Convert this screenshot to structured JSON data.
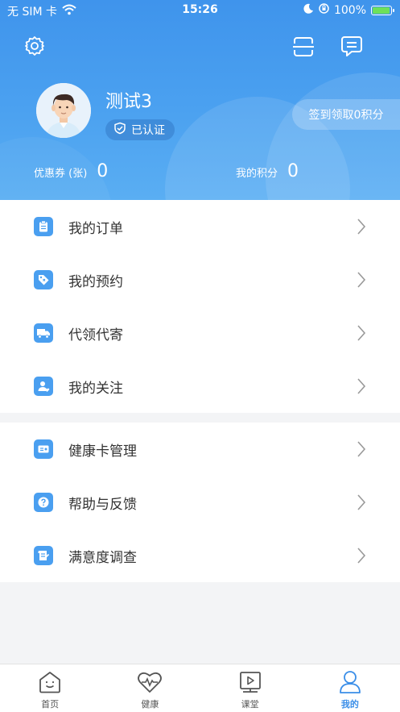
{
  "status_bar": {
    "carrier": "无 SIM 卡",
    "time": "15:26",
    "battery": "100%",
    "battery_level": 1.0
  },
  "profile": {
    "name": "测试3",
    "verified_label": "已认证",
    "checkin_label": "签到领取0积分"
  },
  "stats": {
    "coupons_label": "优惠券 (张)",
    "coupons_value": "0",
    "points_label": "我的积分",
    "points_value": "0"
  },
  "menu_group_1": [
    {
      "label": "我的订单",
      "icon": "clipboard-icon"
    },
    {
      "label": "我的预约",
      "icon": "tag-icon"
    },
    {
      "label": "代领代寄",
      "icon": "truck-icon"
    },
    {
      "label": "我的关注",
      "icon": "user-heart-icon"
    }
  ],
  "menu_group_2": [
    {
      "label": "健康卡管理",
      "icon": "id-card-icon"
    },
    {
      "label": "帮助与反馈",
      "icon": "question-icon"
    },
    {
      "label": "满意度调查",
      "icon": "survey-icon"
    }
  ],
  "tabs": [
    {
      "label": "首页",
      "icon": "home-smile-icon"
    },
    {
      "label": "健康",
      "icon": "heart-pulse-icon"
    },
    {
      "label": "课堂",
      "icon": "video-board-icon"
    },
    {
      "label": "我的",
      "icon": "person-icon",
      "active": true
    }
  ],
  "colors": {
    "brand": "#4a9ff0",
    "active_tab": "#3a8ee8"
  }
}
